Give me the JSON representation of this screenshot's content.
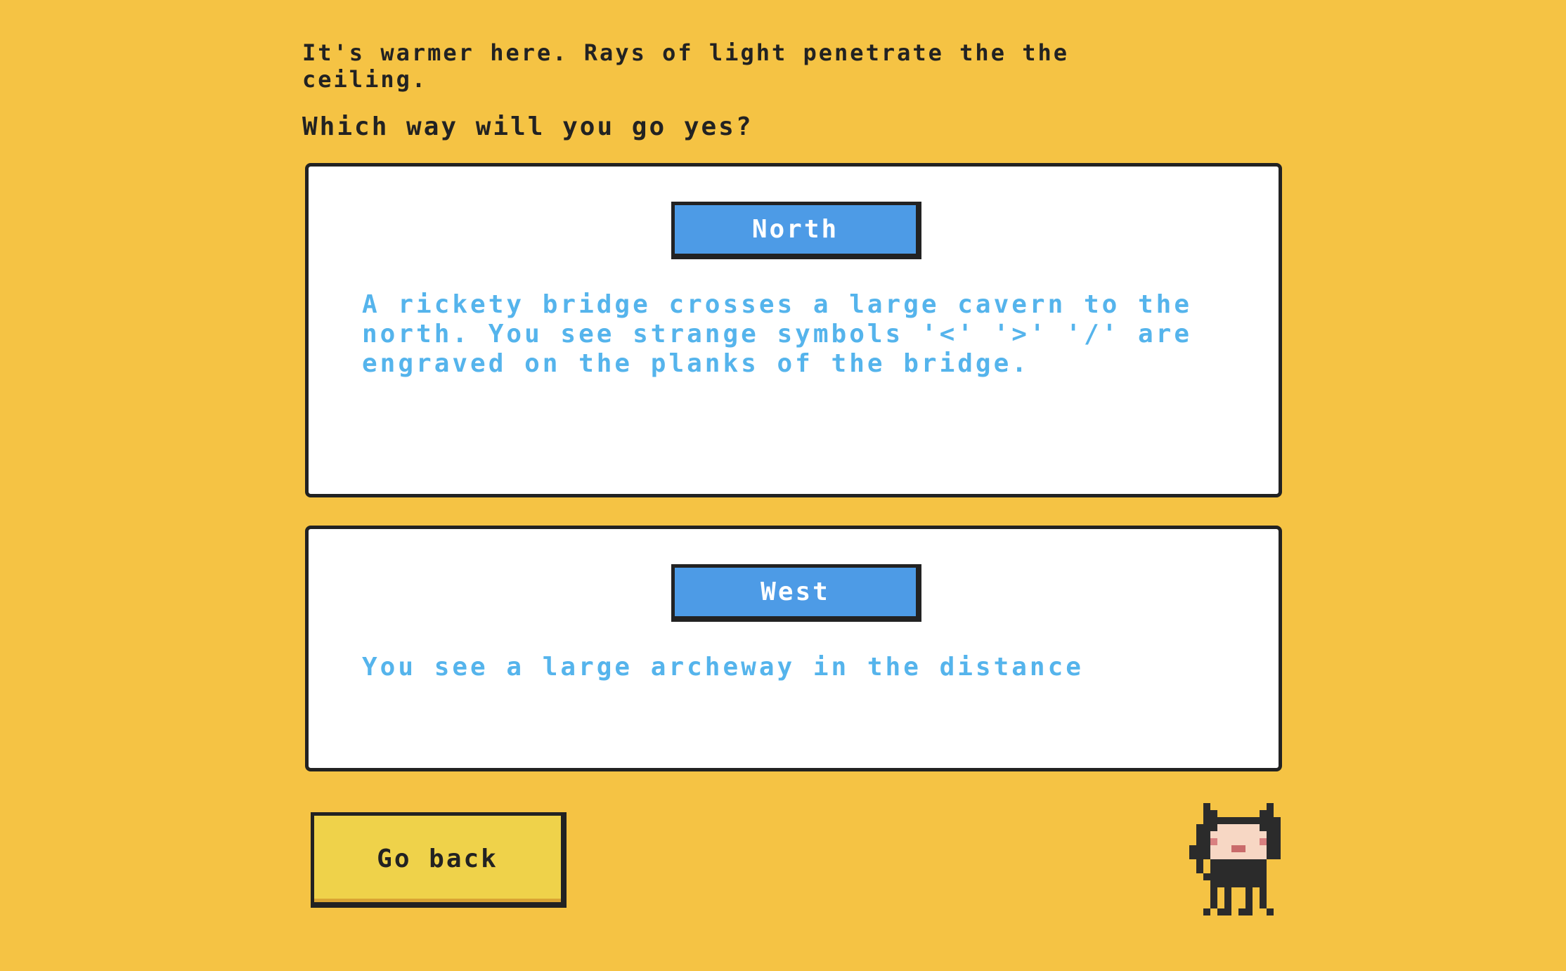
{
  "scene": {
    "description": "It's warmer here. Rays of light penetrate the the ceiling.",
    "prompt": "Which way will you go yes?"
  },
  "choices": [
    {
      "direction": "North",
      "description": "A rickety bridge crosses a large cavern to the north. You see strange symbols '<' '>' '/' are engraved on the planks of the bridge."
    },
    {
      "direction": "West",
      "description": "You see a large archeway in the distance"
    }
  ],
  "actions": {
    "back_label": "Go back"
  },
  "mascot": {
    "icon": "pixel-octocat-icon"
  },
  "colors": {
    "background": "#f5c344",
    "card": "#ffffff",
    "direction_button": "#4d9be6",
    "description_text": "#55b4ec",
    "back_button": "#efd24a",
    "ink": "#222222"
  }
}
